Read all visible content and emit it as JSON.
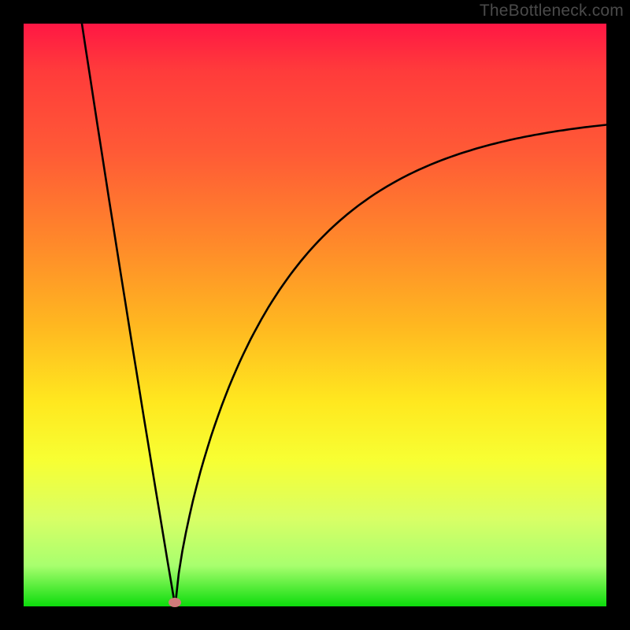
{
  "attribution": "TheBottleneck.com",
  "chart_data": {
    "type": "line",
    "title": "",
    "xlabel": "",
    "ylabel": "",
    "xlim": [
      0,
      100
    ],
    "ylim": [
      0,
      100
    ],
    "curve_minimum_x": 26,
    "curve_minimum_y": 0,
    "curve_left_start": {
      "x": 10,
      "y": 100
    },
    "curve_right_end": {
      "x": 100,
      "y": 85
    },
    "marker": {
      "x": 26,
      "y": 0
    },
    "gradient_stops": [
      {
        "pct": 0,
        "color": "#ff1744"
      },
      {
        "pct": 8,
        "color": "#ff3b3b"
      },
      {
        "pct": 22,
        "color": "#ff5a36"
      },
      {
        "pct": 38,
        "color": "#ff8a2a"
      },
      {
        "pct": 52,
        "color": "#ffb820"
      },
      {
        "pct": 65,
        "color": "#ffe81f"
      },
      {
        "pct": 75,
        "color": "#f7ff33"
      },
      {
        "pct": 85,
        "color": "#d8ff66"
      },
      {
        "pct": 93,
        "color": "#a8ff6e"
      },
      {
        "pct": 100,
        "color": "#0cdc0c"
      }
    ]
  }
}
